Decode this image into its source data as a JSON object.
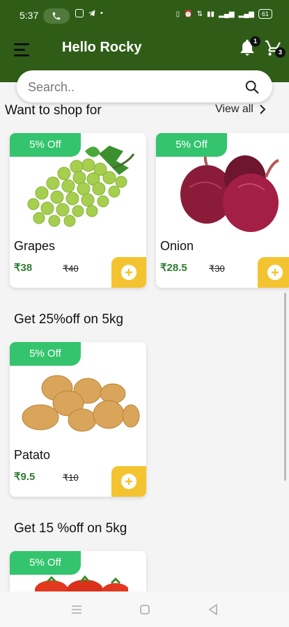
{
  "status": {
    "time": "5:37",
    "battery": "61"
  },
  "header": {
    "greeting": "Hello Rocky",
    "notification_count": "1",
    "cart_count": "3"
  },
  "search": {
    "placeholder": "Search.."
  },
  "sections": {
    "want_to_shop": {
      "title": "Want to shop for",
      "view_all": "View all"
    },
    "offer_25": {
      "title": "Get 25%off on 5kg"
    },
    "offer_15": {
      "title": "Get 15 %off on 5kg"
    }
  },
  "products": {
    "grapes": {
      "discount": "5% Off",
      "name": "Grapes",
      "price": "₹38",
      "mrp": "₹40"
    },
    "onion": {
      "discount": "5% Off",
      "name": "Onion",
      "price": "₹28.5",
      "mrp": "₹30"
    },
    "potato": {
      "discount": "5% Off",
      "name": "Patato",
      "price": "₹9.5",
      "mrp": "₹10"
    },
    "tomato": {
      "discount": "5% Off"
    }
  },
  "colors": {
    "header_green": "#2f5d17",
    "discount_green": "#34c46e",
    "add_yellow": "#f4c430",
    "price_green": "#2e7d32"
  }
}
